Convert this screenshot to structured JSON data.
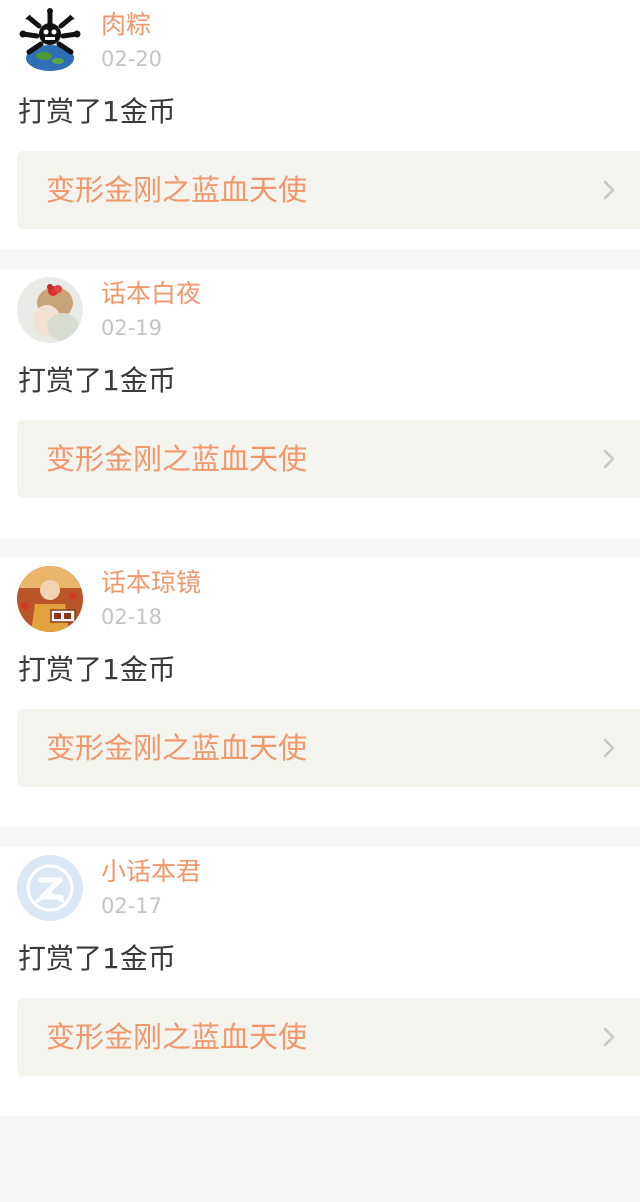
{
  "colors": {
    "accent": "#f0976b",
    "page_bg": "#f7f7f7",
    "card_bg": "#ffffff",
    "link_bg": "#f4f4ef",
    "date_text": "#c4c4c4",
    "body_text": "#3a3a3a",
    "chevron": "#c8c8c8"
  },
  "posts": [
    {
      "username": "肉粽",
      "date": "02-20",
      "action": "打赏了1金币",
      "work_title": "变形金刚之蓝血天使",
      "avatar_icon": "earth-cartoon-avatar-icon",
      "chevron_icon": "chevron-right-icon"
    },
    {
      "username": "话本白夜",
      "date": "02-19",
      "action": "打赏了1金币",
      "work_title": "变形金刚之蓝血天使",
      "avatar_icon": "girl-with-flower-avatar-icon",
      "chevron_icon": "chevron-right-icon"
    },
    {
      "username": "话本琼镜",
      "date": "02-18",
      "action": "打赏了1金币",
      "work_title": "变形金刚之蓝血天使",
      "avatar_icon": "illustrated-character-avatar-icon",
      "chevron_icon": "chevron-right-icon"
    },
    {
      "username": "小话本君",
      "date": "02-17",
      "action": "打赏了1金币",
      "work_title": "变形金刚之蓝血天使",
      "avatar_icon": "default-z-logo-avatar-icon",
      "chevron_icon": "chevron-right-icon"
    }
  ]
}
